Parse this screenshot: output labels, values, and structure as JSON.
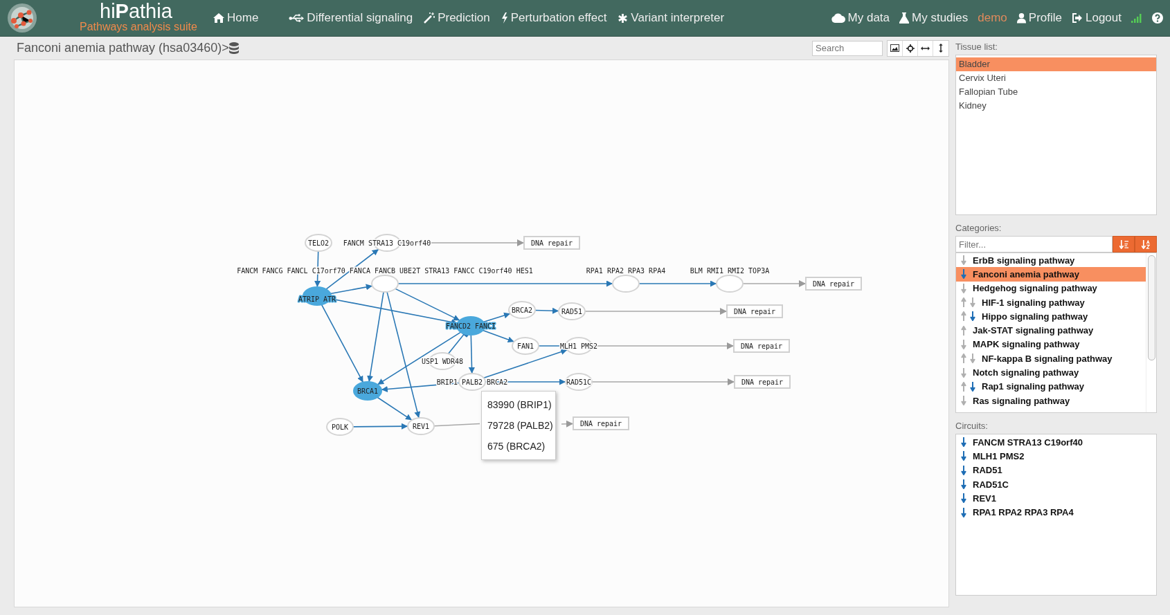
{
  "header": {
    "app_name": "hi**P**athia",
    "subtitle": "Pathways analysis suite",
    "nav": [
      {
        "label": "Home"
      },
      {
        "label": "Differential signaling"
      },
      {
        "label": "Prediction"
      },
      {
        "label": "Perturbation effect"
      },
      {
        "label": "Variant interpreter"
      }
    ],
    "user_nav": [
      {
        "label": "My data",
        "kind": "link"
      },
      {
        "label": "My studies",
        "kind": "link"
      },
      {
        "label": "demo",
        "kind": "user"
      },
      {
        "label": "Profile",
        "kind": "link"
      },
      {
        "label": "Logout",
        "kind": "link"
      }
    ]
  },
  "pathway": {
    "title": "Fanconi anemia pathway (hsa03460)>",
    "search": {
      "placeholder": "Search"
    }
  },
  "diagram": {
    "nodes": [
      {
        "label": "TELO2",
        "kind": "gene",
        "highlighted": false
      },
      {
        "label": "FANCM STRA13 C19orf40",
        "kind": "gene",
        "highlighted": false
      },
      {
        "label": "FANCM FANCG FANCL C17orf70 FANCA FANCB UBE2T STRA13 FANCC C19orf40 HES1",
        "kind": "gene",
        "highlighted": false
      },
      {
        "label": "ATRIP ATR",
        "kind": "gene",
        "highlighted": true
      },
      {
        "label": "RPA1 RPA2 RPA3 RPA4",
        "kind": "gene",
        "highlighted": false
      },
      {
        "label": "BLM RMI1 RMI2 TOP3A",
        "kind": "gene",
        "highlighted": false
      },
      {
        "label": "FANCD2 FANCI",
        "kind": "gene",
        "highlighted": true
      },
      {
        "label": "BRCA2",
        "kind": "gene",
        "highlighted": false
      },
      {
        "label": "RAD51",
        "kind": "gene",
        "highlighted": false
      },
      {
        "label": "FAN1",
        "kind": "gene",
        "highlighted": false
      },
      {
        "label": "MLH1 PMS2",
        "kind": "gene",
        "highlighted": false
      },
      {
        "label": "USP1 WDR48",
        "kind": "gene",
        "highlighted": false
      },
      {
        "label": "BRIP1 PALB2 BRCA2",
        "kind": "gene",
        "highlighted": false
      },
      {
        "label": "RAD51C",
        "kind": "gene",
        "highlighted": false
      },
      {
        "label": "BRCA1",
        "kind": "gene",
        "highlighted": true
      },
      {
        "label": "POLK",
        "kind": "gene",
        "highlighted": false
      },
      {
        "label": "REV1",
        "kind": "gene",
        "highlighted": false
      },
      {
        "label": "DNA repair",
        "kind": "function"
      },
      {
        "label": "DNA repair",
        "kind": "function"
      },
      {
        "label": "DNA repair",
        "kind": "function"
      },
      {
        "label": "DNA repair",
        "kind": "function"
      },
      {
        "label": "DNA repair",
        "kind": "function"
      },
      {
        "label": "DNA repair",
        "kind": "function"
      }
    ],
    "tooltip": [
      "83990 (BRIP1)",
      "79728 (PALB2)",
      "675 (BRCA2)"
    ]
  },
  "tissues": {
    "label": "Tissue list:",
    "items": [
      {
        "label": "Bladder",
        "selected": true
      },
      {
        "label": "Cervix Uteri",
        "selected": false
      },
      {
        "label": "Fallopian Tube",
        "selected": false
      },
      {
        "label": "Kidney",
        "selected": false
      }
    ]
  },
  "categories": {
    "label": "Categories:",
    "filter": {
      "placeholder": "Filter..."
    },
    "items": [
      {
        "label": "ErbB signaling pathway",
        "selected": false,
        "up": false,
        "down": true,
        "significant": false
      },
      {
        "label": "Fanconi anemia pathway",
        "selected": true,
        "up": false,
        "down": true,
        "significant": true
      },
      {
        "label": "Hedgehog signaling pathway",
        "selected": false,
        "up": false,
        "down": true,
        "significant": false
      },
      {
        "label": "HIF-1 signaling pathway",
        "selected": false,
        "up": true,
        "down": true,
        "significant": false
      },
      {
        "label": "Hippo signaling pathway",
        "selected": false,
        "up": true,
        "down": true,
        "significant": true
      },
      {
        "label": "Jak-STAT signaling pathway",
        "selected": false,
        "up": true,
        "down": false
      },
      {
        "label": "MAPK signaling pathway",
        "selected": false,
        "up": false,
        "down": true,
        "significant": false
      },
      {
        "label": "NF-kappa B signaling pathway",
        "selected": false,
        "up": true,
        "down": true,
        "significant": false
      },
      {
        "label": "Notch signaling pathway",
        "selected": false,
        "up": false,
        "down": true,
        "significant": false
      },
      {
        "label": "Rap1 signaling pathway",
        "selected": false,
        "up": true,
        "down": true,
        "significant": true
      },
      {
        "label": "Ras signaling pathway",
        "selected": false,
        "up": false,
        "down": true,
        "significant": false
      }
    ]
  },
  "circuits": {
    "label": "Circuits:",
    "items": [
      {
        "label": "FANCM STRA13 C19orf40",
        "down": true,
        "significant": true
      },
      {
        "label": "MLH1 PMS2",
        "down": true,
        "significant": true
      },
      {
        "label": "RAD51",
        "down": true,
        "significant": true
      },
      {
        "label": "RAD51C",
        "down": true,
        "significant": true
      },
      {
        "label": "REV1",
        "down": true,
        "significant": true
      },
      {
        "label": "RPA1 RPA2 RPA3 RPA4",
        "down": true,
        "significant": true
      }
    ]
  }
}
